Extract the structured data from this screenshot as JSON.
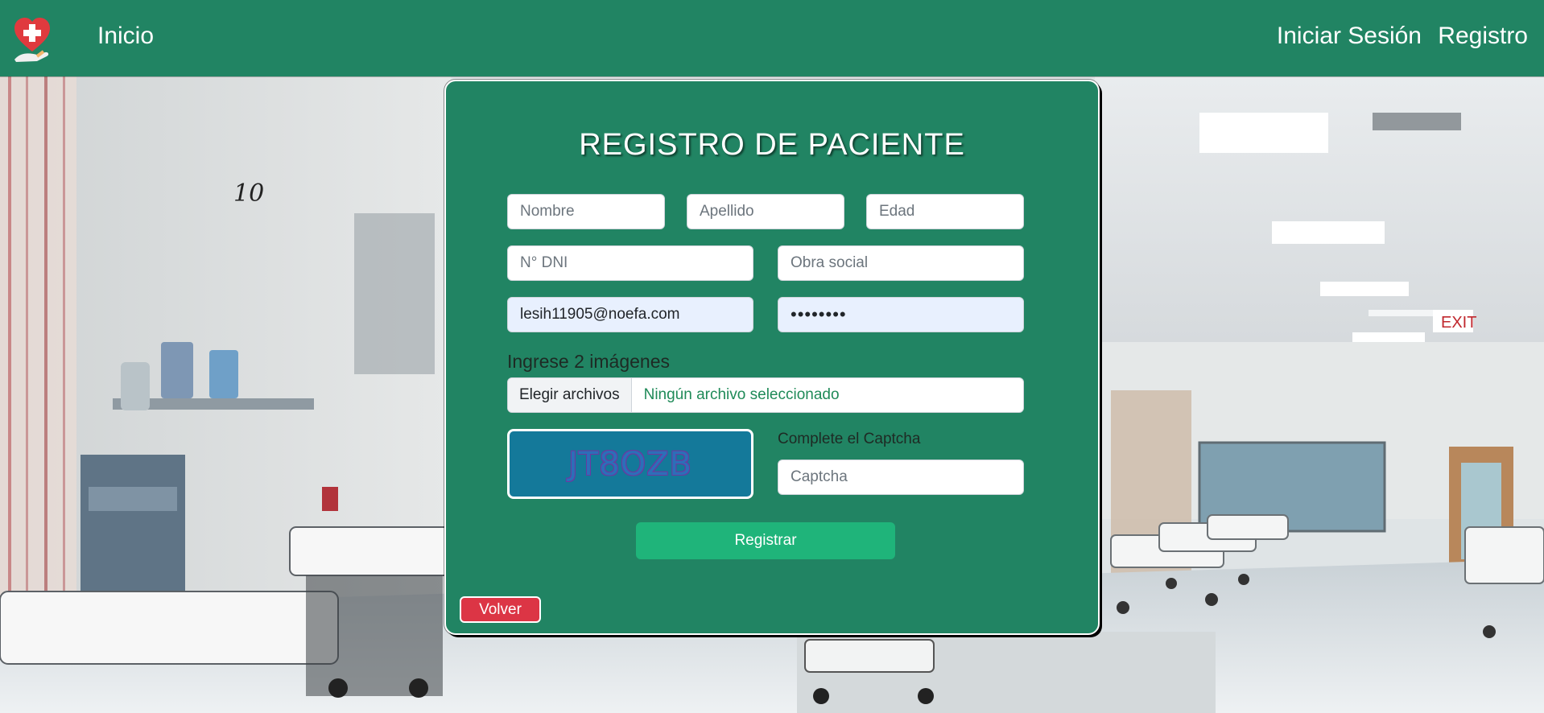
{
  "nav": {
    "home": "Inicio",
    "login": "Iniciar Sesión",
    "register": "Registro",
    "logo_icon": "heart-medical-cross-icon"
  },
  "form": {
    "title": "REGISTRO DE PACIENTE",
    "nombre_placeholder": "Nombre",
    "apellido_placeholder": "Apellido",
    "edad_placeholder": "Edad",
    "dni_placeholder": "N° DNI",
    "obra_social_placeholder": "Obra social",
    "email_value": "lesih11905@noefa.com",
    "password_value": "••••••••",
    "images_label": "Ingrese 2 imágenes",
    "file_button": "Elegir archivos",
    "file_status": "Ningún archivo seleccionado",
    "captcha_code": "JT8OZB",
    "captcha_label": "Complete el Captcha",
    "captcha_placeholder": "Captcha",
    "submit_label": "Registrar",
    "back_label": "Volver"
  },
  "colors": {
    "primary": "#218463",
    "submit": "#1fb47a",
    "back": "#dc3545",
    "captcha_bg": "#14799a"
  }
}
